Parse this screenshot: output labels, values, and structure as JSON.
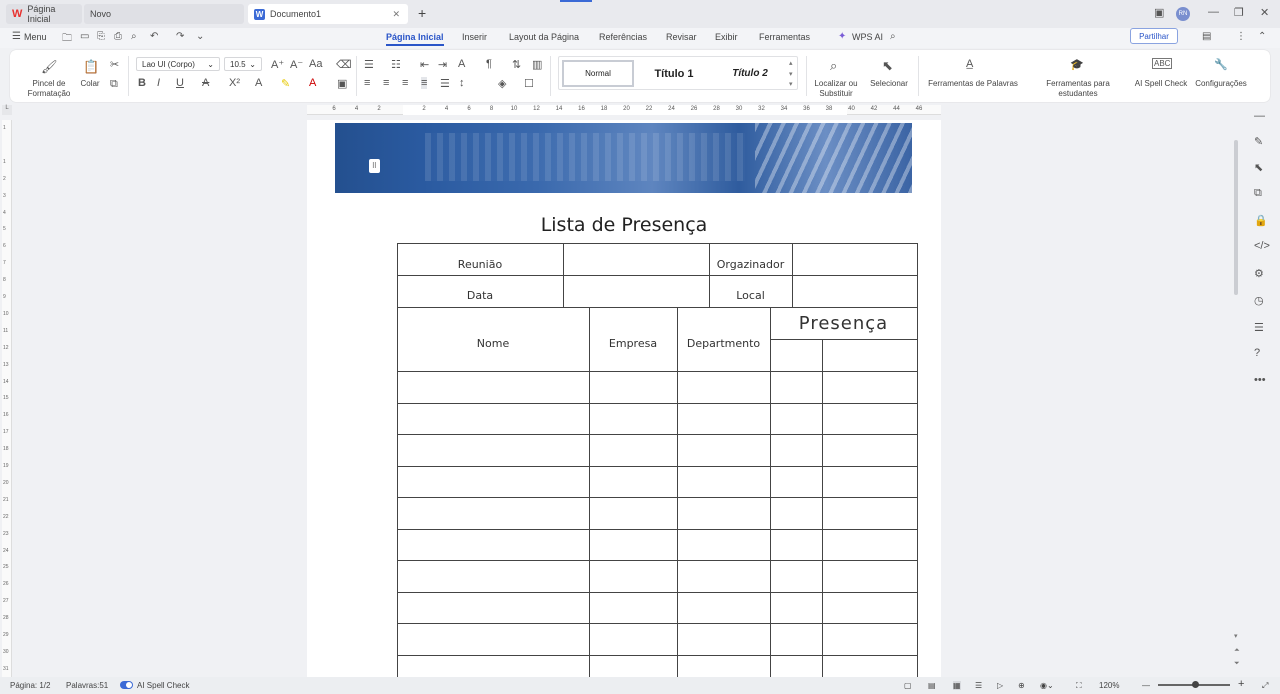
{
  "tabs": [
    {
      "label": "Página Inicial"
    },
    {
      "label": "Novo"
    },
    {
      "label": "Documento1"
    }
  ],
  "menu": {
    "menu_label": "Menu",
    "items": [
      "Página Inicial",
      "Inserir",
      "Layout da Página",
      "Referências",
      "Revisar",
      "Exibir",
      "Ferramentas"
    ],
    "wps_ai": "WPS AI",
    "share": "Partilhar"
  },
  "ribbon": {
    "format_painter": "Pincel de",
    "format_painter2": "Formatação",
    "paste": "Colar",
    "font_name": "Lao UI (Corpo)",
    "font_size": "10.5",
    "styles": [
      "Normal",
      "Título 1",
      "Título 2"
    ],
    "find_replace": "Localizar ou",
    "find_replace2": "Substituir",
    "select": "Selecionar",
    "word_tools": "Ferramentas de Palavras",
    "student_tools": "Ferramentas para estudantes",
    "ai_spell": "AI Spell Check",
    "settings": "Configurações"
  },
  "ruler": {
    "h_ticks": [
      "6",
      "4",
      "2",
      "",
      "2",
      "4",
      "6",
      "8",
      "10",
      "12",
      "14",
      "16",
      "18",
      "20",
      "22",
      "24",
      "26",
      "28",
      "30",
      "32",
      "34",
      "36",
      "38",
      "40",
      "42",
      "44",
      "46"
    ],
    "v_ticks": [
      "1",
      "",
      "1",
      "2",
      "3",
      "4",
      "5",
      "6",
      "7",
      "8",
      "9",
      "10",
      "11",
      "12",
      "13",
      "14",
      "15",
      "16",
      "17",
      "18",
      "19",
      "20",
      "21",
      "22",
      "23",
      "24",
      "25",
      "26",
      "27",
      "28",
      "29",
      "30",
      "31"
    ]
  },
  "document": {
    "title": "Lista de Presença",
    "meeting_label": "Reunião",
    "organizer_label": "Orgazinador",
    "date_label": "Data",
    "place_label": "Local",
    "col_name": "Nome",
    "col_company": "Empresa",
    "col_department": "Departmento",
    "col_presence": "Presença",
    "empty_rows": 10
  },
  "status": {
    "page": "Página: 1/2",
    "words": "Palavras:51",
    "spell": "AI Spell Check",
    "zoom": "120%"
  }
}
